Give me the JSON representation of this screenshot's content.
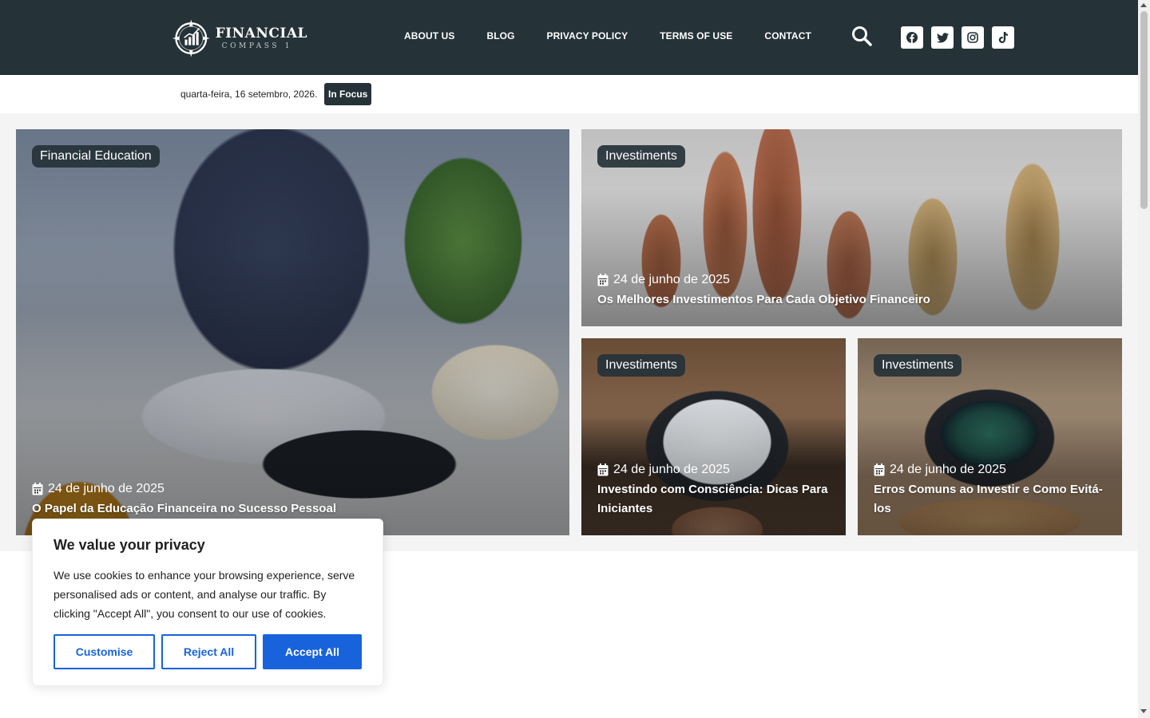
{
  "header": {
    "logo_title": "FINANCIAL",
    "logo_subtitle": "COMPASS 1",
    "nav": [
      "ABOUT US",
      "BLOG",
      "PRIVACY POLICY",
      "TERMS OF USE",
      "CONTACT"
    ],
    "icons": [
      "search-icon",
      "facebook-icon",
      "twitter-icon",
      "instagram-icon",
      "tiktok-icon"
    ]
  },
  "subbar": {
    "date": "quarta-feira, 16 setembro, 2026.",
    "focus_label": "In Focus"
  },
  "featured": [
    {
      "category": "Financial Education",
      "date": "24 de junho de 2025",
      "title": "O Papel da Educação Financeira no Sucesso Pessoal"
    },
    {
      "category": "Investiments",
      "date": "24 de junho de 2025",
      "title": "Os Melhores Investimentos Para Cada Objetivo Financeiro"
    },
    {
      "category": "Investiments",
      "date": "24 de junho de 2025",
      "title": "Investindo com Consciência: Dicas Para Iniciantes"
    },
    {
      "category": "Investiments",
      "date": "24 de junho de 2025",
      "title": "Erros Comuns ao Investir e Como Evitá-los"
    }
  ],
  "cookie": {
    "title": "We value your privacy",
    "text": "We use cookies to enhance your browsing experience, serve personalised ads or content, and analyse our traffic. By clicking \"Accept All\", you consent to our use of cookies.",
    "customise": "Customise",
    "reject": "Reject All",
    "accept": "Accept All"
  },
  "colors": {
    "header_bg": "#253238",
    "accent_blue": "#1863dc"
  }
}
